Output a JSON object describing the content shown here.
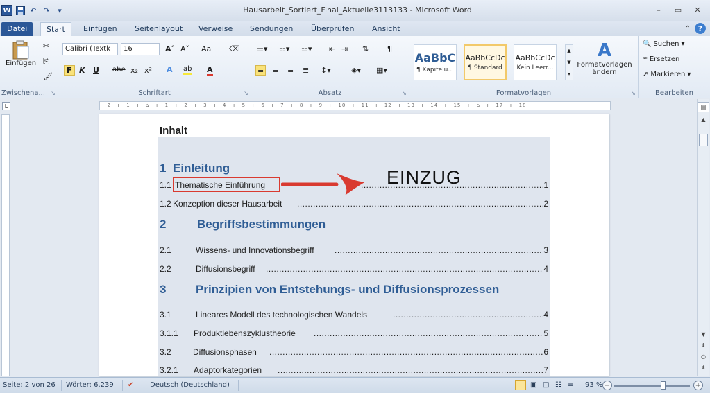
{
  "window": {
    "title": "Hausarbeit_Sortiert_Final_Aktuelle3113133 - Microsoft Word",
    "min": "–",
    "max": "▭",
    "close": "✕"
  },
  "qat": {
    "logo": "W",
    "save": "💾",
    "undo": "↶",
    "redo": "↷",
    "customize": "▾"
  },
  "tabs": [
    "Datei",
    "Start",
    "Einfügen",
    "Seitenlayout",
    "Verweise",
    "Sendungen",
    "Überprüfen",
    "Ansicht"
  ],
  "active_tab": "Start",
  "ribbon": {
    "clipboard": {
      "label": "Zwischena...",
      "paste": "Einfügen"
    },
    "font": {
      "label": "Schriftart",
      "name": "Calibri (Textk",
      "size": "16",
      "bold": "F",
      "italic": "K",
      "underline": "U",
      "strike": "abe",
      "sub": "x₂",
      "sup": "x²",
      "grow": "A˄",
      "shrink": "A˅",
      "case": "Aa",
      "clear": "⌫"
    },
    "paragraph": {
      "label": "Absatz",
      "pilcrow": "¶"
    },
    "styles": {
      "label": "Formatvorlagen",
      "items": [
        {
          "preview": "AaBbC",
          "name": "¶ Kapitelü..."
        },
        {
          "preview": "AaBbCcDc",
          "name": "¶ Standard"
        },
        {
          "preview": "AaBbCcDc",
          "name": "Kein Leerr..."
        }
      ],
      "change": "Formatvorlagen ändern"
    },
    "editing": {
      "label": "Bearbeiten",
      "find": "Suchen",
      "replace": "Ersetzen",
      "select": "Markieren"
    }
  },
  "ruler": {
    "marks": "· 2 · ı · 1 · ı · ⌂ · ı · 1 · ı · 2 · ı · 3 · ı · 4 · ı · 5 · ı · 6 · ı · 7 · ı · 8 · ı · 9 · ı · 10 · ı · 11 · ı · 12 · ı · 13 · ı · 14 · ı · 15 · ı · ⌂ · ı · 17 · ı · 18 ·"
  },
  "document": {
    "title": "Inhalt",
    "toc": [
      {
        "kind": "h1",
        "num": "1",
        "text": "Einleitung"
      },
      {
        "kind": "entry",
        "num": "1.1",
        "text": "Thematische Einführung",
        "page": "1"
      },
      {
        "kind": "entry",
        "num": "1.2",
        "text": "Konzeption dieser Hausarbeit",
        "page": "2"
      },
      {
        "kind": "h1",
        "num": "2",
        "text": "Begriffsbestimmungen"
      },
      {
        "kind": "entry",
        "num": "2.1",
        "text": "Wissens- und Innovationsbegriff",
        "page": "3"
      },
      {
        "kind": "entry",
        "num": "2.2",
        "text": "Diffusionsbegriff",
        "page": "4"
      },
      {
        "kind": "h1",
        "num": "3",
        "text": "Prinzipien von Entstehungs- und Diffusionsprozessen"
      },
      {
        "kind": "entry",
        "num": "3.1",
        "text": "Lineares Modell des technologischen Wandels",
        "page": "4"
      },
      {
        "kind": "entry",
        "num": "3.1.1",
        "text": "Produktlebenszyklustheorie",
        "page": "5"
      },
      {
        "kind": "entry",
        "num": "3.2",
        "text": "Diffusionsphasen",
        "page": "6"
      },
      {
        "kind": "entry",
        "num": "3.2.1",
        "text": "Adaptorkategorien",
        "page": "7"
      }
    ],
    "annotation": "EINZUG",
    "dot_leader": "........................................................................................................................................................"
  },
  "status": {
    "page": "Seite: 2 von 26",
    "words": "Wörter: 6.239",
    "language": "Deutsch (Deutschland)",
    "zoom": "93 %",
    "zoom_minus": "−",
    "zoom_plus": "+"
  },
  "colors": {
    "accent": "#2b5797",
    "heading": "#2f5d95",
    "annotation_red": "#d93a30"
  }
}
